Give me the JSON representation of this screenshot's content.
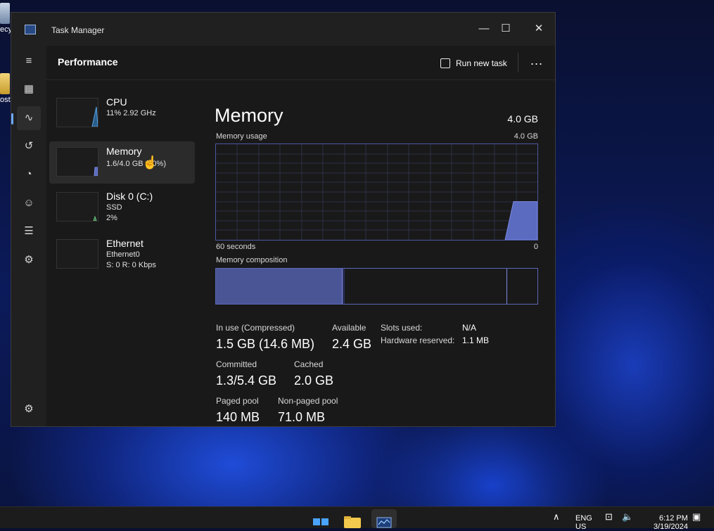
{
  "desktop": {
    "icon1_label": "ecy",
    "icon2_label": "ost"
  },
  "window": {
    "title": "Task Manager",
    "minimize_glyph": "—",
    "maximize_glyph": "☐",
    "close_glyph": "✕"
  },
  "nav": {
    "items": [
      {
        "name": "hamburger-menu-icon",
        "glyph": "≡"
      },
      {
        "name": "processes-icon",
        "glyph": "▦"
      },
      {
        "name": "performance-icon",
        "glyph": "∿"
      },
      {
        "name": "app-history-icon",
        "glyph": "↺"
      },
      {
        "name": "startup-apps-icon",
        "glyph": "◔"
      },
      {
        "name": "users-icon",
        "glyph": "☺"
      },
      {
        "name": "details-icon",
        "glyph": "☰"
      },
      {
        "name": "services-icon",
        "glyph": "⚙"
      }
    ],
    "settings_glyph": "⚙"
  },
  "header": {
    "title": "Performance",
    "run_task_label": "Run new task",
    "more_label": "..."
  },
  "devices": [
    {
      "name": "CPU",
      "sub1": "11% 2.92 GHz",
      "sub2": ""
    },
    {
      "name": "Memory",
      "sub1": "1.6/4.0 GB (40%)",
      "sub2": ""
    },
    {
      "name": "Disk 0 (C:)",
      "sub1": "SSD",
      "sub2": "2%"
    },
    {
      "name": "Ethernet",
      "sub1": "Ethernet0",
      "sub2": "S: 0 R: 0 Kbps"
    }
  ],
  "detail": {
    "title": "Memory",
    "total": "4.0 GB",
    "usage_label": "Memory usage",
    "usage_max": "4.0 GB",
    "time_left": "60 seconds",
    "time_right": "0",
    "composition_label": "Memory composition",
    "usage_level": 0.4,
    "stats": {
      "in_use_label": "In use (Compressed)",
      "in_use_value": "1.5 GB (14.6 MB)",
      "available_label": "Available",
      "available_value": "2.4 GB",
      "slots_label": "Slots used:",
      "slots_value": "N/A",
      "hw_reserved_label": "Hardware reserved:",
      "hw_reserved_value": "1.1 MB",
      "committed_label": "Committed",
      "committed_value": "1.3/5.4 GB",
      "cached_label": "Cached",
      "cached_value": "2.0 GB",
      "paged_label": "Paged pool",
      "paged_value": "140 MB",
      "nonpaged_label": "Non-paged pool",
      "nonpaged_value": "71.0 MB"
    }
  },
  "taskbar": {
    "chevron": "∧",
    "lang_top": "ENG",
    "lang_bottom": "US",
    "time": "6:12 PM",
    "date": "3/19/2024"
  },
  "colors": {
    "accent": "#6aa8ff",
    "memory_fill": "#5a6bc0",
    "memory_border": "#7d8ae0"
  }
}
